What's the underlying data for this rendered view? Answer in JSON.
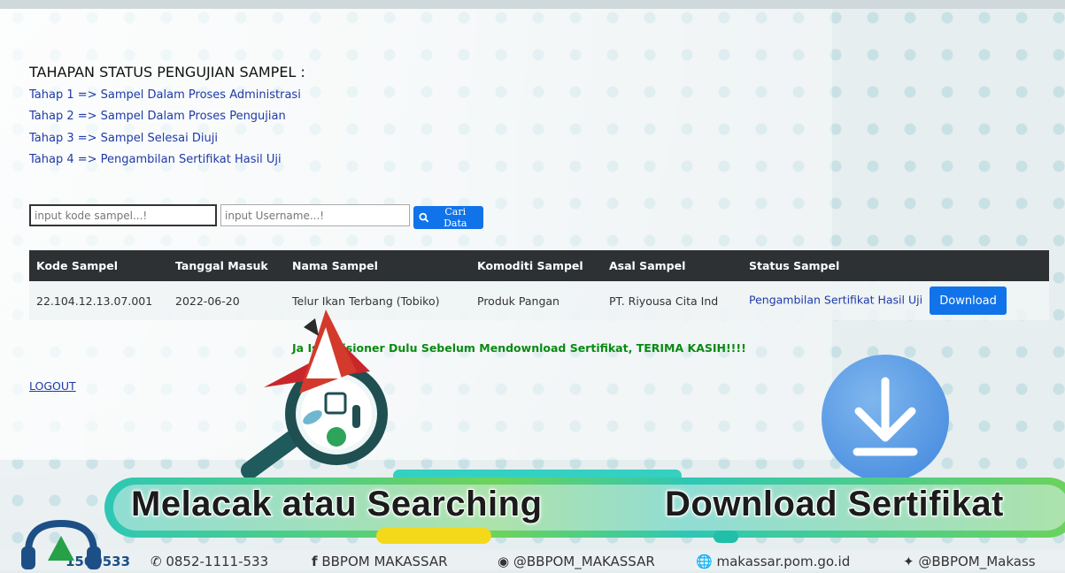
{
  "stages": {
    "title": "TAHAPAN STATUS PENGUJIAN SAMPEL :",
    "items": [
      "Tahap 1 => Sampel Dalam Proses Administrasi",
      "Tahap 2 => Sampel Dalam Proses Pengujian",
      "Tahap 3 => Sampel Selesai Diuji",
      "Tahap 4 => Pengambilan Sertifikat Hasil Uji"
    ]
  },
  "search": {
    "code_placeholder": "input kode sampel...!",
    "username_placeholder": "input Username...!",
    "button_label": "Cari Data"
  },
  "table": {
    "headers": [
      "Kode Sampel",
      "Tanggal Masuk",
      "Nama Sampel",
      "Komoditi Sampel",
      "Asal Sampel",
      "Status Sampel"
    ],
    "rows": [
      {
        "kode": "22.104.12.13.07.001",
        "tanggal": "2022-06-20",
        "nama": "Telur Ikan Terbang (Tobiko)",
        "komoditi": "Produk Pangan",
        "asal": "PT. Riyousa Cita Ind",
        "status": "Pengambilan Sertifikat Hasil Uji",
        "action": "Download"
      }
    ]
  },
  "notice": "Ja          Isi Kuisioner Dulu Sebelum Mendownload Sertifikat, TERIMA KASIH!!!!",
  "logout": "LOGOUT",
  "captions": {
    "left": "Melacak atau Searching",
    "right": "Download Sertifikat"
  },
  "footer": {
    "hotline": "1500533",
    "phone": "0852-1111-533",
    "facebook": "BBPOM MAKASSAR",
    "instagram": "@BBPOM_MAKASSAR",
    "website": "makassar.pom.go.id",
    "twitter": "@BBPOM_Makass"
  },
  "colors": {
    "accent": "#1173ea",
    "link": "#1f3aa8",
    "notice": "#0a8a12",
    "table_header": "#2d3134"
  }
}
